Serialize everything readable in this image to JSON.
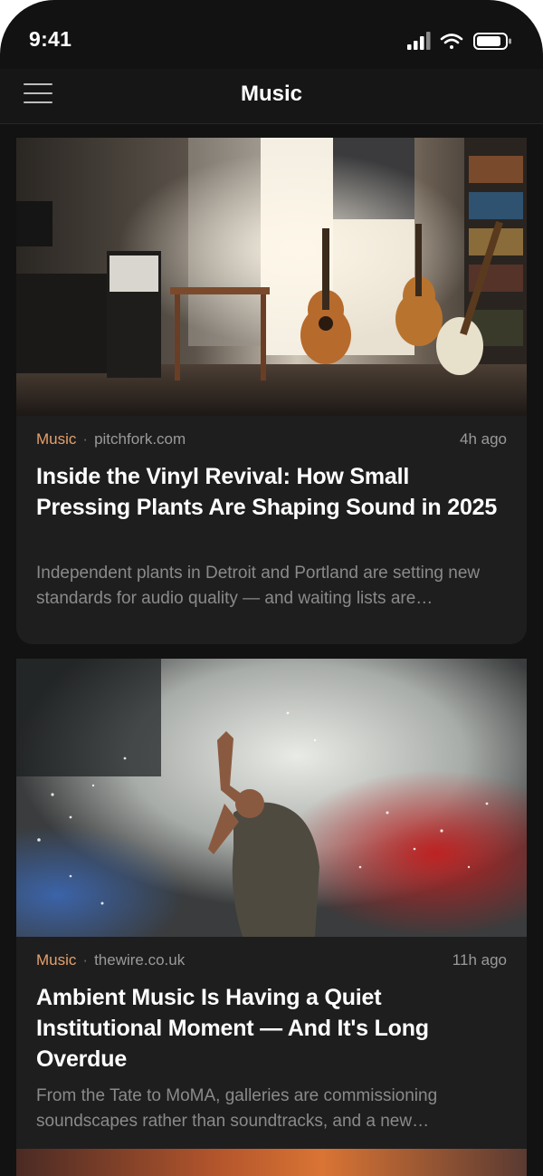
{
  "status": {
    "time": "9:41"
  },
  "header": {
    "title": "Music"
  },
  "articles": [
    {
      "category": "Music",
      "source": "pitchfork.com",
      "time": "4h ago",
      "title": "Inside the Vinyl Revival: How Small Pressing Plants Are Shaping Sound in 2025",
      "summary": "Independent plants in Detroit and Portland are setting new standards for audio quality — and waiting lists are…"
    },
    {
      "category": "Music",
      "source": "thewire.co.uk",
      "time": "11h ago",
      "title": "Ambient Music Is Having a Quiet Institutional Moment — And It's Long Overdue",
      "summary": "From the Tate to MoMA, galleries are commissioning soundscapes rather than soundtracks, and a new…"
    }
  ],
  "colors": {
    "background": "#121212",
    "card": "#1e1e1e",
    "accent": "#e6a06c"
  },
  "icons": [
    "cellular-signal-icon",
    "wifi-icon",
    "battery-icon",
    "hamburger-menu-icon"
  ]
}
